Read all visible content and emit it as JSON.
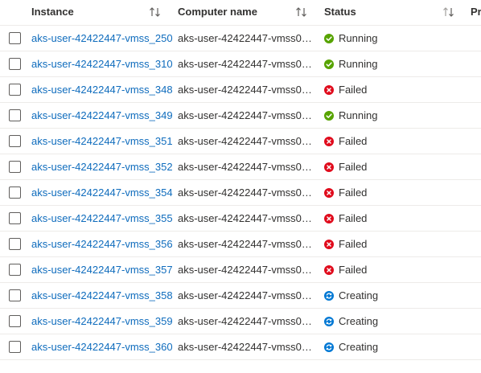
{
  "columns": {
    "instance": "Instance",
    "computer_name": "Computer name",
    "status": "Status",
    "next_partial": "Pr"
  },
  "colors": {
    "link": "#0f6cbd",
    "running": "#57a300",
    "failed": "#e00b1c",
    "creating": "#0078d4",
    "divider": "#edebe9"
  },
  "rows": [
    {
      "instance": "aks-user-42422447-vmss_250",
      "computer_name": "aks-user-42422447-vmss00...",
      "status": "Running",
      "status_icon": "check-circle-icon"
    },
    {
      "instance": "aks-user-42422447-vmss_310",
      "computer_name": "aks-user-42422447-vmss00...",
      "status": "Running",
      "status_icon": "check-circle-icon"
    },
    {
      "instance": "aks-user-42422447-vmss_348",
      "computer_name": "aks-user-42422447-vmss00...",
      "status": "Failed",
      "status_icon": "error-circle-icon"
    },
    {
      "instance": "aks-user-42422447-vmss_349",
      "computer_name": "aks-user-42422447-vmss00...",
      "status": "Running",
      "status_icon": "check-circle-icon"
    },
    {
      "instance": "aks-user-42422447-vmss_351",
      "computer_name": "aks-user-42422447-vmss00...",
      "status": "Failed",
      "status_icon": "error-circle-icon"
    },
    {
      "instance": "aks-user-42422447-vmss_352",
      "computer_name": "aks-user-42422447-vmss00...",
      "status": "Failed",
      "status_icon": "error-circle-icon"
    },
    {
      "instance": "aks-user-42422447-vmss_354",
      "computer_name": "aks-user-42422447-vmss00...",
      "status": "Failed",
      "status_icon": "error-circle-icon"
    },
    {
      "instance": "aks-user-42422447-vmss_355",
      "computer_name": "aks-user-42422447-vmss00...",
      "status": "Failed",
      "status_icon": "error-circle-icon"
    },
    {
      "instance": "aks-user-42422447-vmss_356",
      "computer_name": "aks-user-42422447-vmss00...",
      "status": "Failed",
      "status_icon": "error-circle-icon"
    },
    {
      "instance": "aks-user-42422447-vmss_357",
      "computer_name": "aks-user-42422447-vmss00...",
      "status": "Failed",
      "status_icon": "error-circle-icon"
    },
    {
      "instance": "aks-user-42422447-vmss_358",
      "computer_name": "aks-user-42422447-vmss00...",
      "status": "Creating",
      "status_icon": "sync-circle-icon"
    },
    {
      "instance": "aks-user-42422447-vmss_359",
      "computer_name": "aks-user-42422447-vmss00...",
      "status": "Creating",
      "status_icon": "sync-circle-icon"
    },
    {
      "instance": "aks-user-42422447-vmss_360",
      "computer_name": "aks-user-42422447-vmss00...",
      "status": "Creating",
      "status_icon": "sync-circle-icon"
    }
  ]
}
